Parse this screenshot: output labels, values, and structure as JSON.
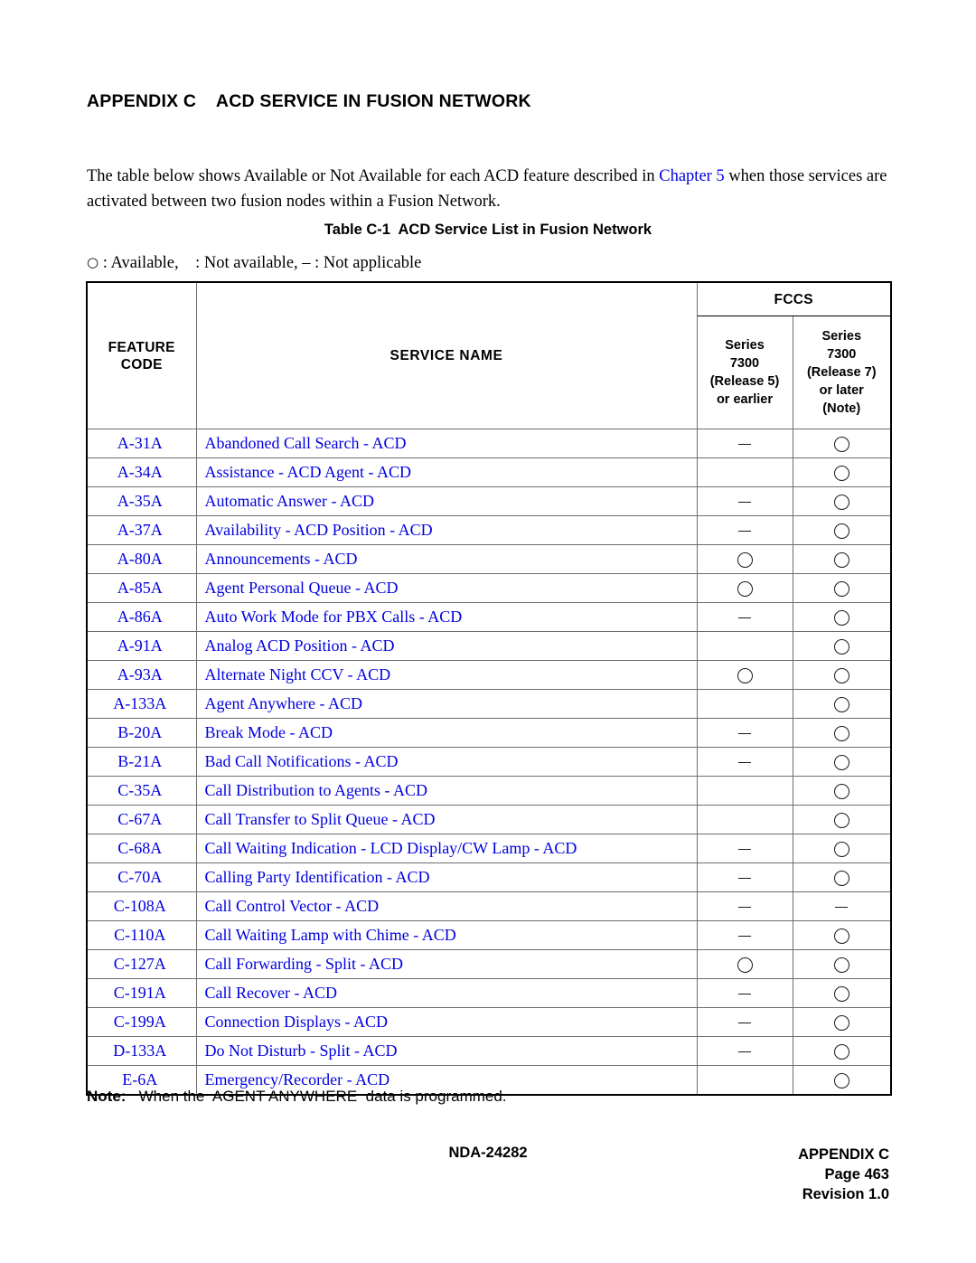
{
  "heading": "APPENDIX C    ACD SERVICE IN FUSION NETWORK",
  "intro": {
    "before_link": "The table below shows Available or Not Available for each ACD feature described in ",
    "link": "Chapter 5",
    "after_link": " when those services are activated between two fusion nodes within a Fusion Network."
  },
  "table_caption": "Table C-1  ACD Service List in Fusion Network",
  "legend": {
    "circle_symbol": "○",
    "text": " : Available,    : Not available, – : Not applicable"
  },
  "table": {
    "headers": {
      "feature_code": "FEATURE\nCODE",
      "service_name": "SERVICE NAME",
      "fccs": "FCCS",
      "release5": "Series\n7300\n(Release 5)\nor earlier",
      "release7": "Series\n7300\n(Release 7)\nor later\n(Note)"
    },
    "rows": [
      {
        "code": "A-31A",
        "name": "Abandoned Call Search - ACD",
        "release5": "dash",
        "release7": "circle"
      },
      {
        "code": "A-34A",
        "name": "Assistance - ACD Agent - ACD",
        "release5": "blank",
        "release7": "circle"
      },
      {
        "code": "A-35A",
        "name": "Automatic Answer - ACD",
        "release5": "dash",
        "release7": "circle"
      },
      {
        "code": "A-37A",
        "name": "Availability - ACD Position - ACD",
        "release5": "dash",
        "release7": "circle"
      },
      {
        "code": "A-80A",
        "name": "Announcements - ACD",
        "release5": "circle",
        "release7": "circle"
      },
      {
        "code": "A-85A",
        "name": "Agent Personal Queue - ACD",
        "release5": "circle",
        "release7": "circle"
      },
      {
        "code": "A-86A",
        "name": "Auto Work Mode for PBX Calls - ACD",
        "release5": "dash",
        "release7": "circle"
      },
      {
        "code": "A-91A",
        "name": "Analog ACD Position - ACD",
        "release5": "blank",
        "release7": "circle"
      },
      {
        "code": "A-93A",
        "name": "Alternate Night CCV - ACD",
        "release5": "circle",
        "release7": "circle"
      },
      {
        "code": "A-133A",
        "name": "Agent Anywhere - ACD",
        "release5": "blank",
        "release7": "circle"
      },
      {
        "code": "B-20A",
        "name": "Break Mode - ACD",
        "release5": "dash",
        "release7": "circle"
      },
      {
        "code": "B-21A",
        "name": "Bad Call Notifications - ACD",
        "release5": "dash",
        "release7": "circle"
      },
      {
        "code": "C-35A",
        "name": "Call Distribution to Agents - ACD",
        "release5": "blank",
        "release7": "circle"
      },
      {
        "code": "C-67A",
        "name": "Call Transfer to Split Queue - ACD",
        "release5": "blank",
        "release7": "circle"
      },
      {
        "code": "C-68A",
        "name": "Call Waiting Indication - LCD Display/CW Lamp - ACD",
        "release5": "dash",
        "release7": "circle"
      },
      {
        "code": "C-70A",
        "name": "Calling Party Identification - ACD",
        "release5": "dash",
        "release7": "circle"
      },
      {
        "code": "C-108A",
        "name": "Call Control Vector - ACD",
        "release5": "dash",
        "release7": "dash"
      },
      {
        "code": "C-110A",
        "name": "Call Waiting Lamp with Chime - ACD",
        "release5": "dash",
        "release7": "circle"
      },
      {
        "code": "C-127A",
        "name": "Call Forwarding - Split - ACD",
        "release5": "circle",
        "release7": "circle"
      },
      {
        "code": "C-191A",
        "name": "Call Recover - ACD",
        "release5": "dash",
        "release7": "circle"
      },
      {
        "code": "C-199A",
        "name": "Connection Displays - ACD",
        "release5": "dash",
        "release7": "circle"
      },
      {
        "code": "D-133A",
        "name": "Do Not Disturb - Split - ACD",
        "release5": "dash",
        "release7": "circle"
      },
      {
        "code": "E-6A",
        "name": "Emergency/Recorder - ACD",
        "release5": "blank",
        "release7": "circle"
      }
    ]
  },
  "note": {
    "label": "Note:",
    "text": "   When the  AGENT ANYWHERE  data is programmed."
  },
  "footer": {
    "doc_number": "NDA-24282",
    "appendix": "APPENDIX C",
    "page": "Page 463",
    "revision": "Revision 1.0"
  },
  "colors": {
    "link_blue": "#0000E0",
    "table_text_blue": "#0000E0",
    "border_gray": "#6e6e6e",
    "border_black": "#000000"
  }
}
